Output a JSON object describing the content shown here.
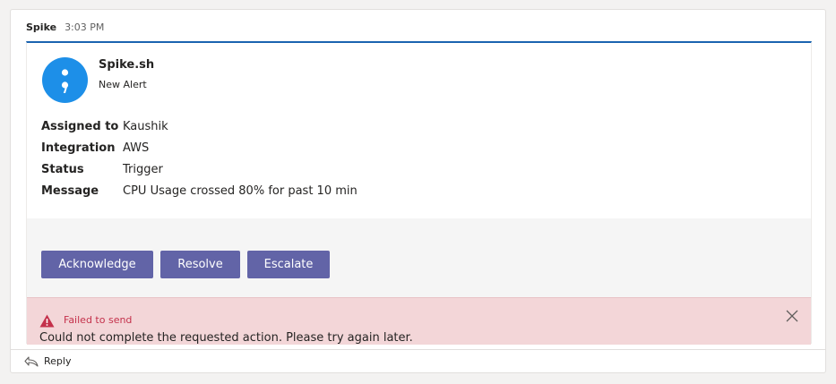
{
  "message": {
    "sender": "Spike",
    "time": "3:03 PM"
  },
  "card": {
    "app_icon": "semicolon-logo-icon",
    "app_name": "Spike.sh",
    "subtitle": "New Alert",
    "facts": [
      {
        "key": "Assigned to",
        "value": "Kaushik"
      },
      {
        "key": "Integration",
        "value": "AWS"
      },
      {
        "key": "Status",
        "value": "Trigger"
      },
      {
        "key": "Message",
        "value": "CPU Usage crossed 80% for past 10 min"
      }
    ],
    "actions": [
      {
        "label": "Acknowledge"
      },
      {
        "label": "Resolve"
      },
      {
        "label": "Escalate"
      }
    ]
  },
  "error": {
    "icon": "warning-triangle-icon",
    "title": "Failed to send",
    "message": "Could not complete the requested action. Please try again later.",
    "close_icon": "close-icon"
  },
  "reply": {
    "icon": "reply-arrow-icon",
    "label": "Reply"
  },
  "colors": {
    "accent": "#6264a7",
    "card_top_border": "#1a64b0",
    "avatar_bg": "#1d8fe8",
    "error_bg": "#f3d6d8",
    "error_text": "#c4314b"
  }
}
